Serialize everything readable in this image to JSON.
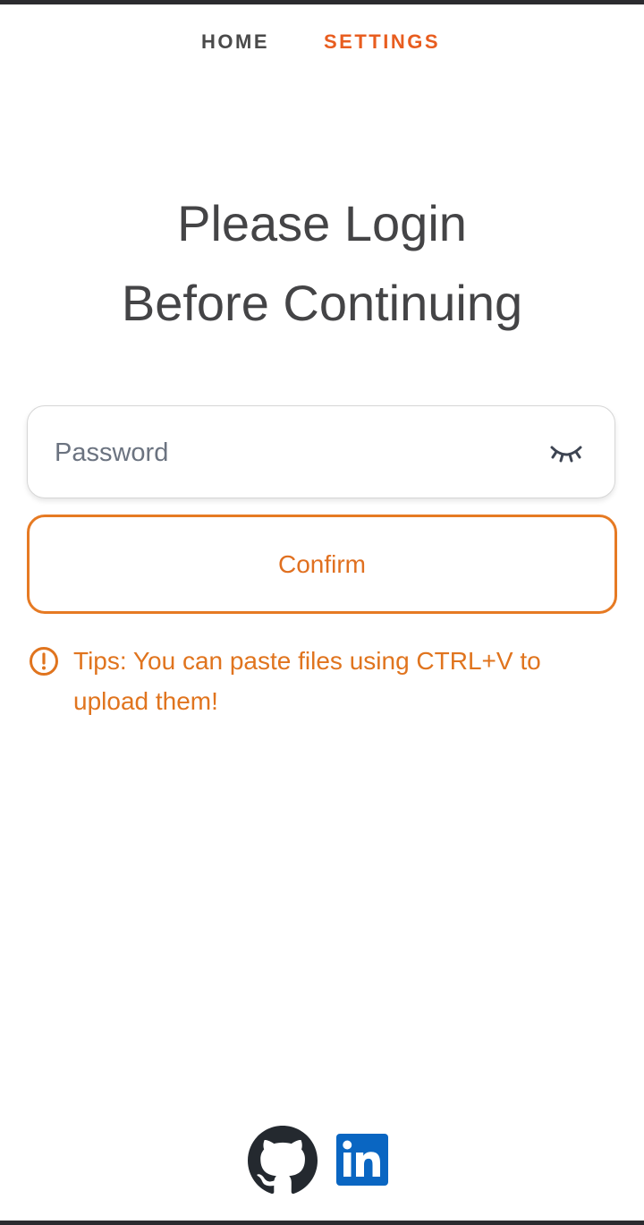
{
  "nav": {
    "home_label": "HOME",
    "settings_label": "SETTINGS"
  },
  "title": {
    "line1": "Please Login",
    "line2": "Before Continuing"
  },
  "password": {
    "placeholder": "Password",
    "value": "",
    "toggle_icon": "eye-closed-icon"
  },
  "confirm": {
    "label": "Confirm"
  },
  "tip": {
    "icon": "alert-circle-icon",
    "text": "Tips: You can paste files using CTRL+V to upload them!"
  },
  "social": {
    "items": [
      {
        "icon": "github-icon"
      },
      {
        "icon": "linkedin-icon"
      }
    ]
  },
  "colors": {
    "accent": "#e67a23",
    "active_nav": "#e85d1f",
    "title_text": "#444446",
    "linkedin_blue": "#0a66c2",
    "github_dark": "#24292f"
  }
}
